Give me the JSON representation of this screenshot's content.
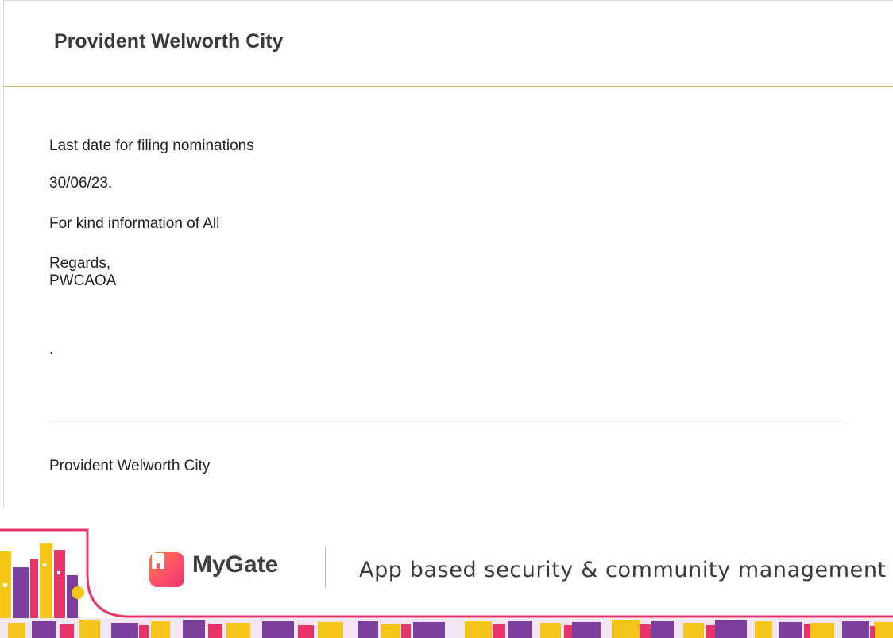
{
  "header": {
    "title": "Provident Welworth City"
  },
  "message": {
    "line1": "Last date for filing nominations",
    "line2": "30/06/23.",
    "line3": "For kind information of All",
    "signature": "Regards,\nPWCAOA",
    "trailing": "."
  },
  "footer": {
    "society_name": "Provident Welworth City"
  },
  "banner": {
    "brand": "MyGate",
    "tagline": "App based security & community management",
    "logo_icon": "mygate-logo-icon",
    "colors": {
      "accent_pink": "#e8346a",
      "purple": "#7b3f9e",
      "yellow": "#f5c518",
      "orange": "#ff7a3d"
    }
  }
}
